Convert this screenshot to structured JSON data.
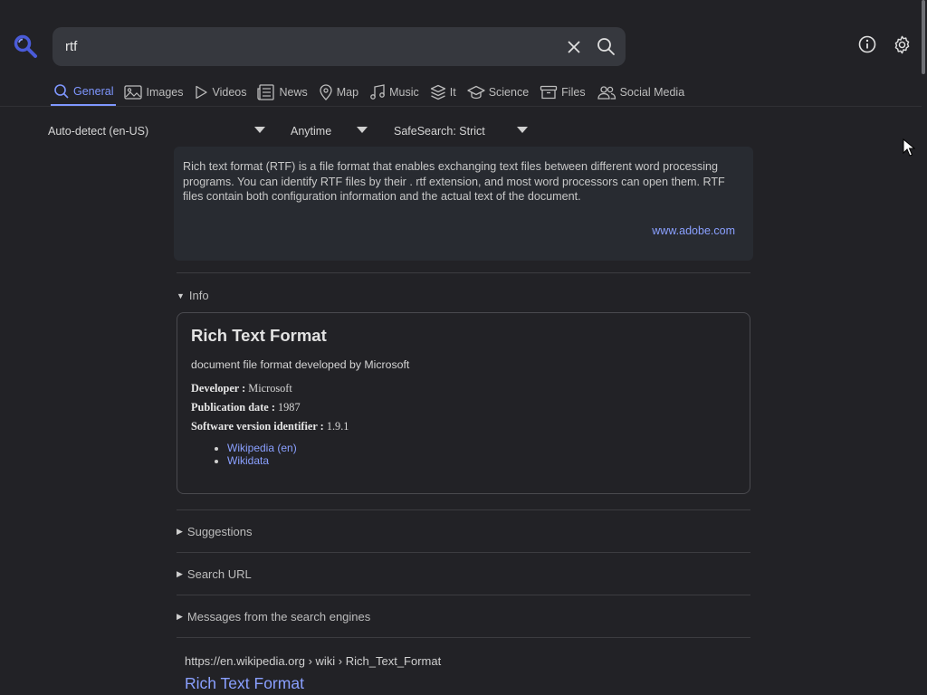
{
  "search": {
    "query": "rtf"
  },
  "tabs": [
    {
      "label": "General",
      "icon": "search-icon",
      "active": true
    },
    {
      "label": "Images",
      "icon": "image-icon"
    },
    {
      "label": "Videos",
      "icon": "play-icon"
    },
    {
      "label": "News",
      "icon": "newspaper-icon"
    },
    {
      "label": "Map",
      "icon": "map-pin-icon"
    },
    {
      "label": "Music",
      "icon": "music-note-icon"
    },
    {
      "label": "It",
      "icon": "layers-icon"
    },
    {
      "label": "Science",
      "icon": "graduation-cap-icon"
    },
    {
      "label": "Files",
      "icon": "archive-box-icon"
    },
    {
      "label": "Social Media",
      "icon": "people-icon"
    }
  ],
  "filters": {
    "language": "Auto-detect (en-US)",
    "time": "Anytime",
    "safesearch": "SafeSearch: Strict"
  },
  "answer": {
    "text": "Rich text format (RTF) is a file format that enables exchanging text files between different word processing programs. You can identify RTF files by their . rtf extension, and most word processors can open them. RTF files contain both configuration information and the actual text of the document.",
    "source": "www.adobe.com"
  },
  "info": {
    "toggle_label": "Info",
    "title": "Rich Text Format",
    "description": "document file format developed by Microsoft",
    "rows": [
      {
        "label": "Developer :",
        "value": "Microsoft"
      },
      {
        "label": "Publication date :",
        "value": "1987"
      },
      {
        "label": "Software version identifier :",
        "value": "1.9.1"
      }
    ],
    "links": [
      "Wikipedia (en)",
      "Wikidata"
    ]
  },
  "sections": {
    "suggestions": "Suggestions",
    "search_url": "Search URL",
    "messages": "Messages from the search engines"
  },
  "result": {
    "url": "https://en.wikipedia.org  › wiki › Rich_Text_Format",
    "title": "Rich Text Format"
  },
  "colors": {
    "accent": "#7f97ff",
    "link": "#8aa0ff",
    "background": "#222226"
  }
}
